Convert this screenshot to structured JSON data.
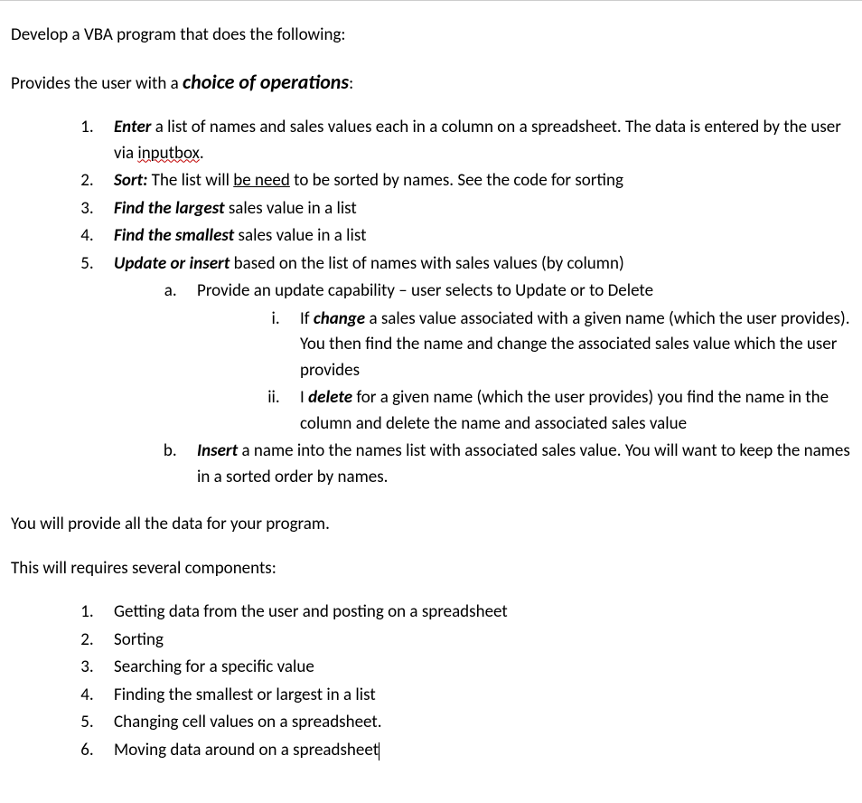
{
  "intro1": "Develop a VBA program that does the following:",
  "intro2_pre": "Provides the user with a ",
  "intro2_em": "choice of operations",
  "intro2_post": ":",
  "list1": {
    "item1": {
      "bold": "Enter",
      "text": " a list of names and sales values each in a column on a spreadsheet.  The data is entered by the user via ",
      "squiggly": "inputbox",
      "after": "."
    },
    "item2": {
      "bold": "Sort:",
      "pre": " The list will ",
      "underline": "be need",
      "post": " to be sorted by names.  See the code for sorting"
    },
    "item3": {
      "bold": "Find the largest",
      "text": " sales value in a list"
    },
    "item4": {
      "bold": "Find the smallest",
      "text": " sales value in a list"
    },
    "item5": {
      "bold": " Update or insert",
      "text": " based on the list of names with sales values (by column)",
      "a": {
        "text": "Provide an update capability – user selects to Update or to Delete",
        "i": {
          "pre": "If ",
          "bold": "change",
          "post": "  a sales value associated with a given name (which the user provides).  You then find the name and change the associated sales value which the user provides"
        },
        "ii": {
          "pre": "I ",
          "bold": "delete",
          "post": "  for a given name (which the user provides) you find the name in the column and delete the name and associated sales value"
        }
      },
      "b": {
        "bold": "Insert",
        "text": " a name into the names list with associated sales value. You will want to keep the names in a sorted order by names."
      }
    }
  },
  "mid1": "You will provide all the data for your program.",
  "mid2": "This will requires several components:",
  "list2": {
    "item1": "Getting data from the user and posting on a spreadsheet",
    "item2": "Sorting",
    "item3": "Searching for a specific value",
    "item4": "Finding the smallest or largest in a list",
    "item5": "Changing cell values on a spreadsheet.",
    "item6": "Moving data around on a spreadsheet"
  }
}
